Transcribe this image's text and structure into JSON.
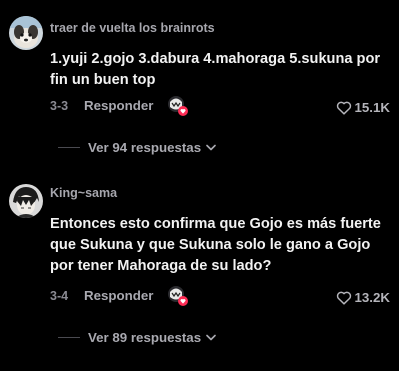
{
  "comments": [
    {
      "username": "traer de vuelta los brainrots",
      "text": "1.yuji 2.gojo 3.dabura 4.mahoraga 5.sukuna por fin un buen top",
      "date": "3-3",
      "reply_label": "Responder",
      "likes": "15.1K",
      "view_replies": "Ver 94 respuestas",
      "avatar_icon": "dog-avatar-icon"
    },
    {
      "username": "King~sama",
      "text": "Entonces esto confirma que Gojo es más fuerte que Sukuna y que Sukuna solo le gano a Gojo por tener Mahoraga de su lado?",
      "date": "3-4",
      "reply_label": "Responder",
      "likes": "13.2K",
      "view_replies": "Ver 89 respuestas",
      "avatar_icon": "manga-character-avatar-icon"
    }
  ],
  "icons": {
    "heart": "heart-outline-icon",
    "creator_like": "creator-liked-badge-icon",
    "chevron": "chevron-down-icon"
  },
  "colors": {
    "background": "#000000",
    "username": "#a6a6ad",
    "text": "#f2f2f2",
    "muted": "#8a8a92",
    "creator_badge": "#fe2c55"
  }
}
